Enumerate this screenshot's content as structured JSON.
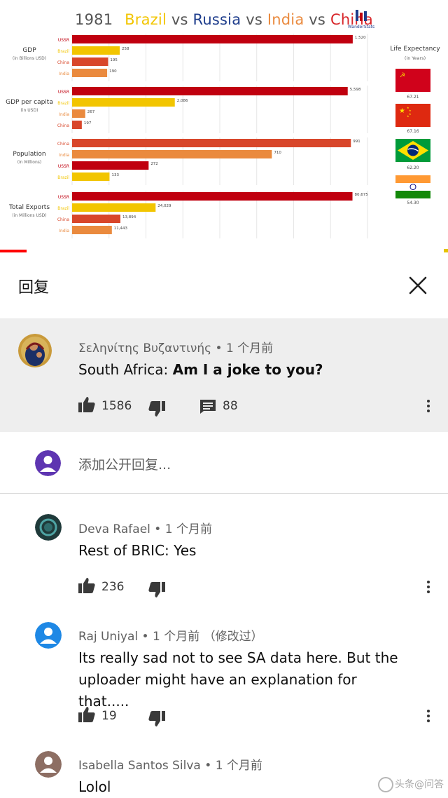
{
  "video": {
    "title": {
      "year": "1981",
      "brazil": "Brazil",
      "vs1": "vs",
      "russia": "Russia",
      "vs2": "vs",
      "india": "India",
      "vs3": "vs",
      "china": "China"
    },
    "logo_text": "WanderStats",
    "life_expectancy": {
      "title": "Life Expectancy",
      "unit": "(in Years)",
      "items": [
        {
          "country": "USSR",
          "value": "67.21",
          "flag": "ussr-flag-icon"
        },
        {
          "country": "China",
          "value": "67.16",
          "flag": "china-flag-icon"
        },
        {
          "country": "Brazil",
          "value": "62.20",
          "flag": "brazil-flag-icon"
        },
        {
          "country": "India",
          "value": "54.30",
          "flag": "india-flag-icon"
        }
      ]
    },
    "colors": {
      "USSR": "#c0000f",
      "Brazil": "#f2c500",
      "China": "#d8462a",
      "India": "#ea8a3e"
    },
    "sections": [
      {
        "label": "GDP",
        "unit": "(in Billions USD)",
        "max": 1600,
        "rows": [
          {
            "country": "USSR",
            "value": 1520,
            "value_label": "1,520"
          },
          {
            "country": "Brazil",
            "value": 258,
            "value_label": "258"
          },
          {
            "country": "China",
            "value": 195,
            "value_label": "195"
          },
          {
            "country": "India",
            "value": 190,
            "value_label": "190"
          }
        ]
      },
      {
        "label": "GDP per capita",
        "unit": "(in USD)",
        "max": 6000,
        "rows": [
          {
            "country": "USSR",
            "value": 5598,
            "value_label": "5,598"
          },
          {
            "country": "Brazil",
            "value": 2086,
            "value_label": "2,086"
          },
          {
            "country": "India",
            "value": 267,
            "value_label": "267"
          },
          {
            "country": "China",
            "value": 197,
            "value_label": "197"
          }
        ]
      },
      {
        "label": "Population",
        "unit": "(in Millions)",
        "max": 1050,
        "rows": [
          {
            "country": "China",
            "value": 991,
            "value_label": "991"
          },
          {
            "country": "India",
            "value": 710,
            "value_label": "710"
          },
          {
            "country": "USSR",
            "value": 272,
            "value_label": "272"
          },
          {
            "country": "Brazil",
            "value": 133,
            "value_label": "133"
          }
        ]
      },
      {
        "label": "Total Exports",
        "unit": "(in Millions USD)",
        "max": 85000,
        "rows": [
          {
            "country": "USSR",
            "value": 80675,
            "value_label": "80,675"
          },
          {
            "country": "Brazil",
            "value": 24029,
            "value_label": "24,029"
          },
          {
            "country": "China",
            "value": 13894,
            "value_label": "13,894"
          },
          {
            "country": "India",
            "value": 11443,
            "value_label": "11,443"
          }
        ]
      }
    ]
  },
  "replies_header": {
    "title": "回复",
    "close_icon": "close-icon"
  },
  "parent_comment": {
    "author": "Σεληνίτης Βυζαντινής",
    "time": "1 个月前",
    "text_prefix": "South Africa: ",
    "text_bold": "Am I a joke to you?",
    "likes": "1586",
    "replies": "88"
  },
  "add_reply": {
    "placeholder": "添加公开回复..."
  },
  "replies": [
    {
      "author": "Deva Rafael",
      "time": "1 个月前",
      "text": "Rest of BRIC: Yes",
      "likes": "236",
      "edited": ""
    },
    {
      "author": "Raj Uniyal",
      "time": "1 个月前",
      "edited": "（修改过）",
      "text": "Its really sad not to see SA data here. But the uploader might have an explanation for that.....",
      "likes": "19"
    },
    {
      "author": "Isabella Santos Silva",
      "time": "1 个月前",
      "text": "Lolol",
      "likes": "",
      "edited": ""
    }
  ],
  "watermark": "头条@问答"
}
